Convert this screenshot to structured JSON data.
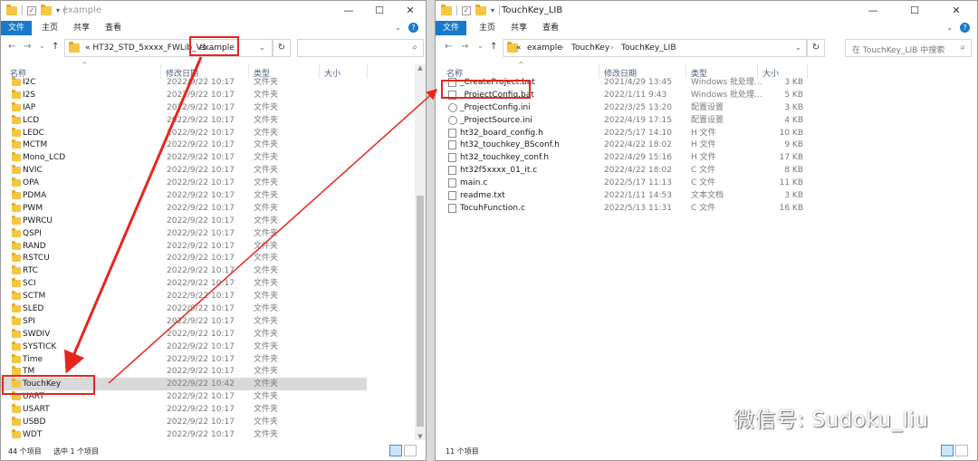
{
  "left": {
    "title": "example",
    "ribbon": {
      "file": "文件",
      "home": "主页",
      "share": "共享",
      "view": "查看"
    },
    "address": {
      "chevrons": "«",
      "path": "HT32_STD_5xxxx_FWLib_V1...",
      "current": "example"
    },
    "columns": {
      "name": "名称",
      "date": "修改日期",
      "type": "类型",
      "size": "大小"
    },
    "rows": [
      {
        "name": "I2C",
        "date": "2022/9/22 10:17",
        "type": "文件夹"
      },
      {
        "name": "I2S",
        "date": "2022/9/22 10:17",
        "type": "文件夹"
      },
      {
        "name": "IAP",
        "date": "2022/9/22 10:17",
        "type": "文件夹"
      },
      {
        "name": "LCD",
        "date": "2022/9/22 10:17",
        "type": "文件夹"
      },
      {
        "name": "LEDC",
        "date": "2022/9/22 10:17",
        "type": "文件夹"
      },
      {
        "name": "MCTM",
        "date": "2022/9/22 10:17",
        "type": "文件夹"
      },
      {
        "name": "Mono_LCD",
        "date": "2022/9/22 10:17",
        "type": "文件夹"
      },
      {
        "name": "NVIC",
        "date": "2022/9/22 10:17",
        "type": "文件夹"
      },
      {
        "name": "OPA",
        "date": "2022/9/22 10:17",
        "type": "文件夹"
      },
      {
        "name": "PDMA",
        "date": "2022/9/22 10:17",
        "type": "文件夹"
      },
      {
        "name": "PWM",
        "date": "2022/9/22 10:17",
        "type": "文件夹"
      },
      {
        "name": "PWRCU",
        "date": "2022/9/22 10:17",
        "type": "文件夹"
      },
      {
        "name": "QSPI",
        "date": "2022/9/22 10:17",
        "type": "文件夹"
      },
      {
        "name": "RAND",
        "date": "2022/9/22 10:17",
        "type": "文件夹"
      },
      {
        "name": "RSTCU",
        "date": "2022/9/22 10:17",
        "type": "文件夹"
      },
      {
        "name": "RTC",
        "date": "2022/9/22 10:17",
        "type": "文件夹"
      },
      {
        "name": "SCI",
        "date": "2022/9/22 10:17",
        "type": "文件夹"
      },
      {
        "name": "SCTM",
        "date": "2022/9/22 10:17",
        "type": "文件夹"
      },
      {
        "name": "SLED",
        "date": "2022/9/22 10:17",
        "type": "文件夹"
      },
      {
        "name": "SPI",
        "date": "2022/9/22 10:17",
        "type": "文件夹"
      },
      {
        "name": "SWDIV",
        "date": "2022/9/22 10:17",
        "type": "文件夹"
      },
      {
        "name": "SYSTICK",
        "date": "2022/9/22 10:17",
        "type": "文件夹"
      },
      {
        "name": "Time",
        "date": "2022/9/22 10:17",
        "type": "文件夹"
      },
      {
        "name": "TM",
        "date": "2022/9/22 10:17",
        "type": "文件夹"
      },
      {
        "name": "TouchKey",
        "date": "2022/9/22 10:42",
        "type": "文件夹",
        "selected": true
      },
      {
        "name": "UART",
        "date": "2022/9/22 10:17",
        "type": "文件夹"
      },
      {
        "name": "USART",
        "date": "2022/9/22 10:17",
        "type": "文件夹"
      },
      {
        "name": "USBD",
        "date": "2022/9/22 10:17",
        "type": "文件夹"
      },
      {
        "name": "WDT",
        "date": "2022/9/22 10:17",
        "type": "文件夹"
      }
    ],
    "status": {
      "count": "44 个项目",
      "selected": "选中 1 个项目"
    }
  },
  "right": {
    "title": "TouchKey_LIB",
    "ribbon": {
      "file": "文件",
      "home": "主页",
      "share": "共享",
      "view": "查看"
    },
    "address": {
      "chevrons": "«",
      "seg1": "example",
      "seg2": "TouchKey",
      "seg3": "TouchKey_LIB"
    },
    "search_placeholder": "在 TouchKey_LIB 中搜索",
    "columns": {
      "name": "名称",
      "date": "修改日期",
      "type": "类型",
      "size": "大小"
    },
    "rows": [
      {
        "name": "_CreateProject.bat",
        "date": "2021/4/29 13:45",
        "type": "Windows 批处理...",
        "size": "3 KB",
        "icon": "batch-file-icon"
      },
      {
        "name": "_ProjectConfig.bat",
        "date": "2022/1/11 9:43",
        "type": "Windows 批处理...",
        "size": "5 KB",
        "icon": "batch-file-icon"
      },
      {
        "name": "_ProjectConfig.ini",
        "date": "2022/3/25 13:20",
        "type": "配置设置",
        "size": "3 KB",
        "icon": "config-file-icon"
      },
      {
        "name": "_ProjectSource.ini",
        "date": "2022/4/19 17:15",
        "type": "配置设置",
        "size": "4 KB",
        "icon": "config-file-icon"
      },
      {
        "name": "ht32_board_config.h",
        "date": "2022/5/17 14:10",
        "type": "H 文件",
        "size": "10 KB",
        "icon": "file-icon"
      },
      {
        "name": "ht32_touchkey_BSconf.h",
        "date": "2022/4/22 18:02",
        "type": "H 文件",
        "size": "9 KB",
        "icon": "file-icon"
      },
      {
        "name": "ht32_touchkey_conf.h",
        "date": "2022/4/29 15:16",
        "type": "H 文件",
        "size": "17 KB",
        "icon": "file-icon"
      },
      {
        "name": "ht32f5xxxx_01_it.c",
        "date": "2022/4/22 18:02",
        "type": "C 文件",
        "size": "8 KB",
        "icon": "file-icon"
      },
      {
        "name": "main.c",
        "date": "2022/5/17 11:13",
        "type": "C 文件",
        "size": "11 KB",
        "icon": "file-icon"
      },
      {
        "name": "readme.txt",
        "date": "2022/1/11 14:53",
        "type": "文本文档",
        "size": "3 KB",
        "icon": "text-file-icon"
      },
      {
        "name": "TocuhFunction.c",
        "date": "2022/5/13 11:31",
        "type": "C 文件",
        "size": "16 KB",
        "icon": "file-icon"
      }
    ],
    "status": {
      "count": "11 个项目"
    }
  },
  "watermark": {
    "text": "微信号: Sudoku_liu",
    "icon": "wechat-icon"
  },
  "colors": {
    "accent": "#1979ca",
    "highlight": "#e8251c",
    "selection": "#d9d9d9",
    "folder": "#f5c643"
  }
}
